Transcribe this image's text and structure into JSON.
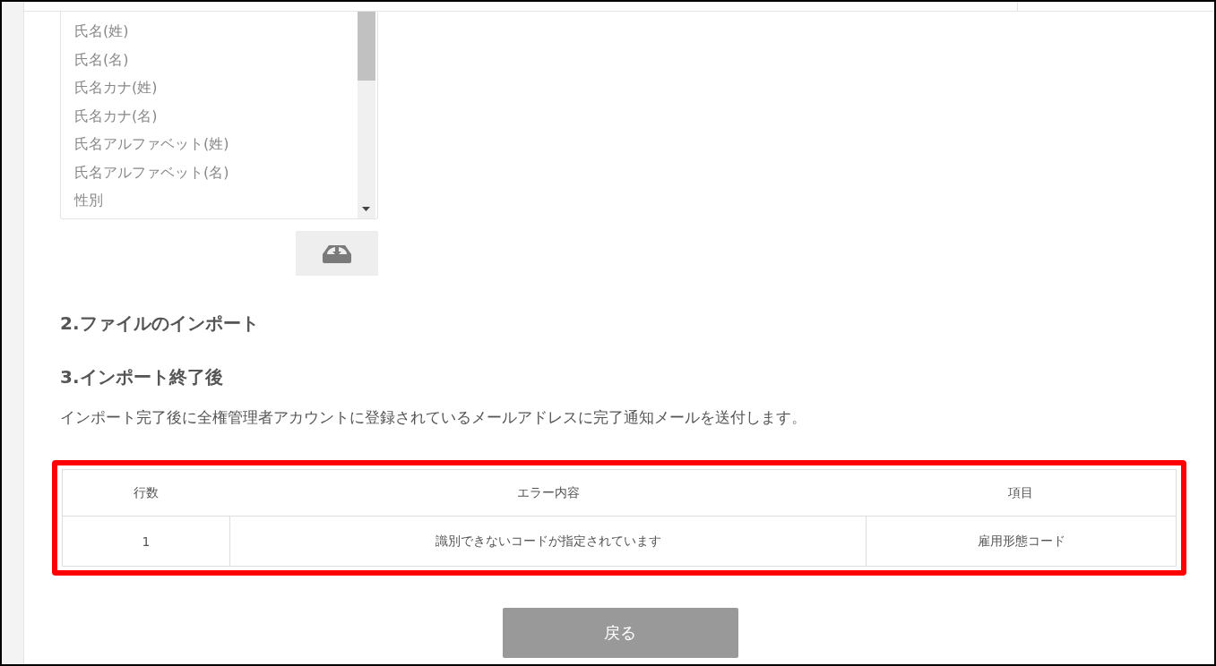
{
  "field_list": {
    "items": [
      "氏名(姓)",
      "氏名(名)",
      "氏名カナ(姓)",
      "氏名カナ(名)",
      "氏名アルファベット(姓)",
      "氏名アルファベット(名)",
      "性別"
    ]
  },
  "sections": [
    {
      "title": "2.ファイルのインポート"
    },
    {
      "title": "3.インポート終了後",
      "description": "インポート完了後に全権管理者アカウントに登録されているメールアドレスに完了通知メールを送付します。"
    }
  ],
  "error_table": {
    "highlighted": true,
    "columns": [
      "行数",
      "エラー内容",
      "項目"
    ],
    "rows": [
      [
        "1",
        "識別できないコードが指定されています",
        "雇用形態コード"
      ]
    ]
  },
  "back_button": {
    "label": "戻る"
  }
}
